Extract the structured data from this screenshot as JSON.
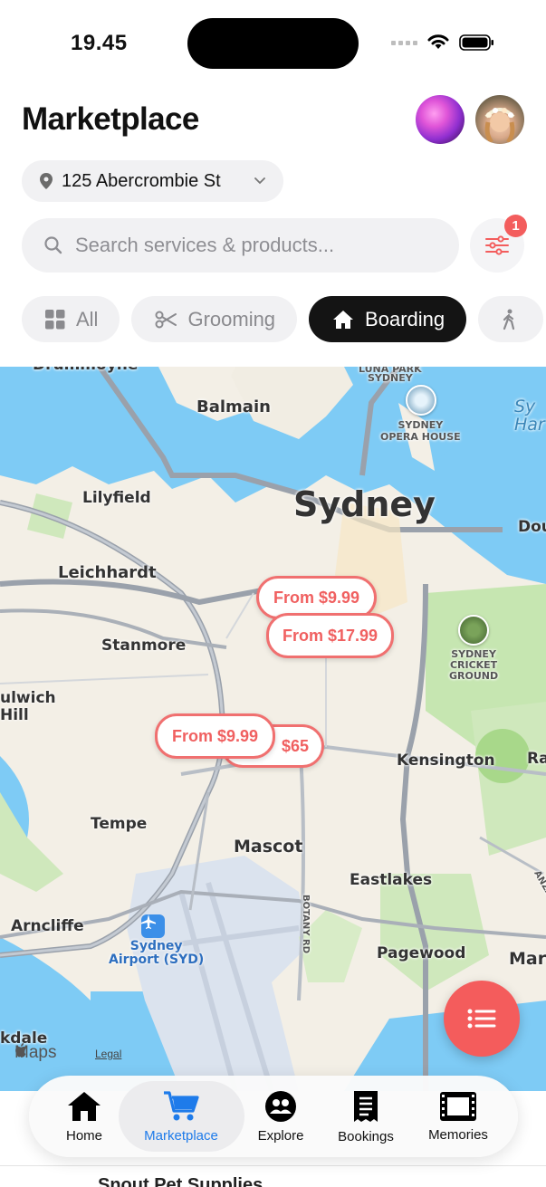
{
  "status_bar": {
    "time": "19.45"
  },
  "header": {
    "title": "Marketplace"
  },
  "location": {
    "address": "125 Abercrombie St"
  },
  "search": {
    "placeholder": "Search services & products..."
  },
  "filter": {
    "badge_count": "1"
  },
  "categories": [
    {
      "label": "All",
      "icon": "grid-icon",
      "active": false
    },
    {
      "label": "Grooming",
      "icon": "scissors-icon",
      "active": false
    },
    {
      "label": "Boarding",
      "icon": "house-icon",
      "active": true
    },
    {
      "label": "",
      "icon": "walking-icon",
      "active": false
    }
  ],
  "map": {
    "labels": {
      "drummoyne": "Drummoyne",
      "balmain": "Balmain",
      "luna_park": "LUNA PARK",
      "sydney_small": "SYDNEY",
      "opera_house": "SYDNEY\nOPERA HOUSE",
      "sydney_harbour": "Sy\nHar",
      "lilyfield": "Lilyfield",
      "sydney": "Sydney",
      "dou": "Dou",
      "leichhardt": "Leichhardt",
      "stanmore": "Stanmore",
      "cricket_ground": "SYDNEY\nCRICKET\nGROUND",
      "dulwich_hill": "ulwich\nHill",
      "kensington": "Kensington",
      "ra": "Ra",
      "tempe": "Tempe",
      "mascot": "Mascot",
      "eastlakes": "Eastlakes",
      "botany_rd": "BOTANY RD",
      "anzac_pde": "ANZAC PDE",
      "arncliffe": "Arncliffe",
      "airport": "Sydney\nAirport (SYD)",
      "pagewood": "Pagewood",
      "maro": "Maro",
      "kdale": "kdale",
      "maps_logo": "Maps",
      "legal": "Legal"
    },
    "price_pins": [
      {
        "label": "From $9.99"
      },
      {
        "label": "From $17.99"
      },
      {
        "label": "$65"
      },
      {
        "label": "From $9.99"
      }
    ]
  },
  "tabs": [
    {
      "label": "Home",
      "icon": "home-icon",
      "active": false
    },
    {
      "label": "Marketplace",
      "icon": "cart-icon",
      "active": true
    },
    {
      "label": "Explore",
      "icon": "people-icon",
      "active": false
    },
    {
      "label": "Bookings",
      "icon": "receipt-icon",
      "active": false
    },
    {
      "label": "Memories",
      "icon": "film-icon",
      "active": false
    }
  ],
  "footer_peek": "Snout Pet Supplies",
  "colors": {
    "accent": "#F45C5C",
    "tab_active": "#1E7BEA",
    "chip_active": "#141414"
  }
}
